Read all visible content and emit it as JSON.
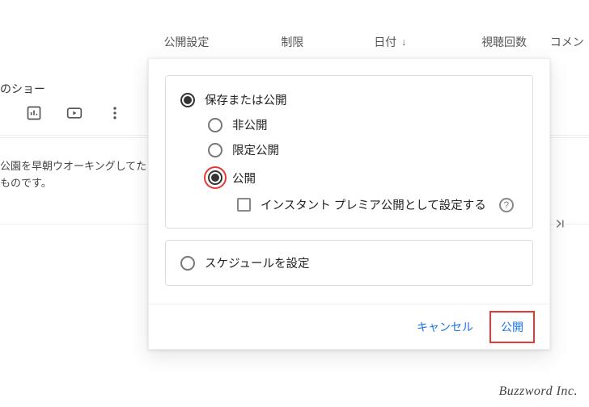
{
  "header": {
    "visibility": "公開設定",
    "restriction": "制限",
    "date": "日付",
    "views": "視聴回数",
    "comments": "コメン"
  },
  "row1": {
    "title": "のショー"
  },
  "row2": {
    "desc": "公園を早朝ウオーキングしてたものです。"
  },
  "panel": {
    "save_or_publish": "保存または公開",
    "private": "非公開",
    "unlisted": "限定公開",
    "public": "公開",
    "instant_premiere": "インスタント プレミア公開として設定する",
    "schedule": "スケジュールを設定"
  },
  "footer": {
    "cancel": "キャンセル",
    "publish": "公開"
  },
  "watermark": "Buzzword Inc."
}
